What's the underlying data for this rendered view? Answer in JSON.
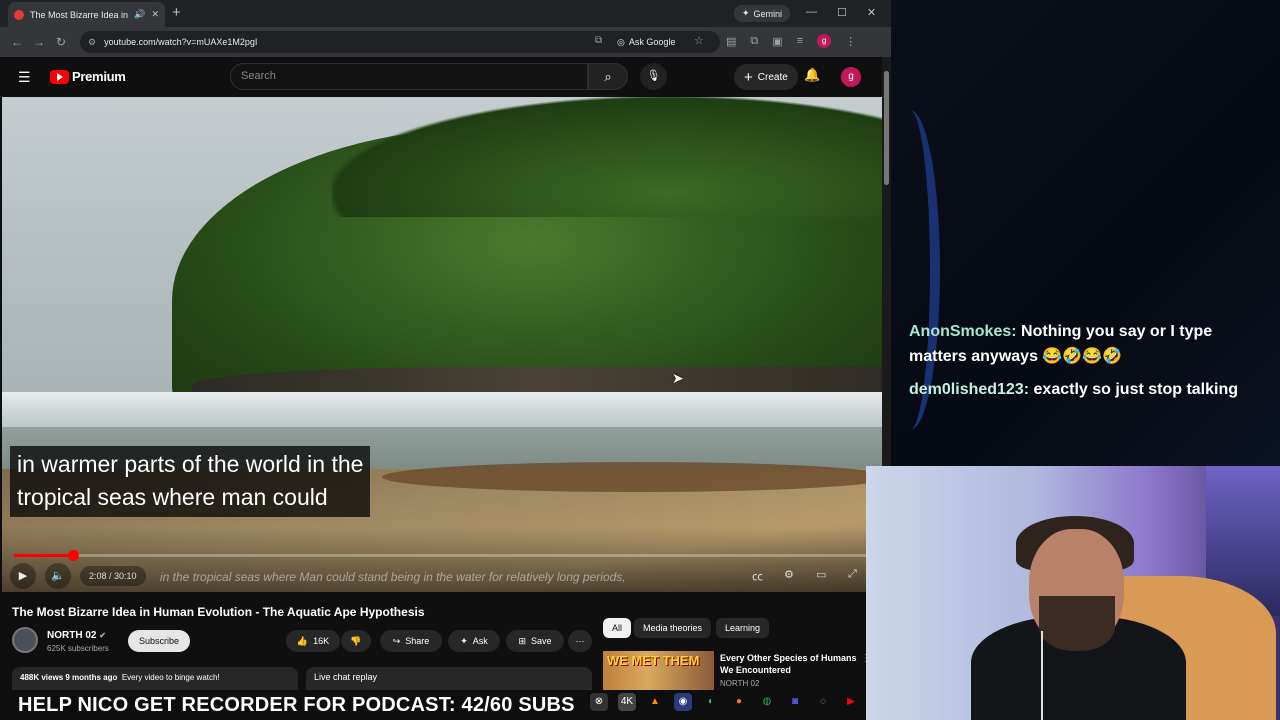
{
  "browser": {
    "tab_title": "The Most Bizarre Idea in Hu",
    "new_tab": "+",
    "gemini_label": "Gemini",
    "address": "youtube.com/watch?v=mUAXe1M2pgI",
    "ask_google": "Ask Google",
    "profile_initial": "g"
  },
  "youtube": {
    "logo_text": "Premium",
    "search_placeholder": "Search",
    "create_label": "Create",
    "avatar_initial": "g",
    "captions": [
      "in warmer parts of the world in the",
      "tropical seas where man could"
    ],
    "burned_in_subtitle": "in the tropical seas where Man could stand being in the water for relatively long periods,",
    "progress_fraction": 0.069,
    "time": "2:08 / 30:10",
    "video_title": "The Most Bizarre Idea in Human Evolution - The Aquatic Ape Hypothesis",
    "channel_name": "NORTH 02",
    "channel_subs": "625K subscribers",
    "subscribe_label": "Subscribe",
    "likes": "16K",
    "share_label": "Share",
    "ask_label": "Ask",
    "save_label": "Save",
    "views": "488K views",
    "age": "9 months ago",
    "desc_snippet": "Every video to binge watch!",
    "live_chat_replay": "Live chat replay",
    "chips": [
      "All",
      "Media theories",
      "Learning"
    ],
    "rec_thumb_text": "WE MET THEM",
    "rec_title": "Every Other Species of Humans We Encountered",
    "rec_channel": "NORTH 02"
  },
  "chat": [
    {
      "user": "AnonSmokes:",
      "text": "Nothing you say or I type matters anyways 😂🤣😂🤣"
    },
    {
      "user": "dem0lished123:",
      "text": "exactly so just stop talking"
    }
  ],
  "banner": {
    "text": "HELP NICO GET RECORDER FOR PODCAST: 42/60 SUBS"
  },
  "colors": {
    "accent_red": "#ff0000",
    "chat_username": "#a8e6cf",
    "yt_bg": "#0f0f0f"
  }
}
